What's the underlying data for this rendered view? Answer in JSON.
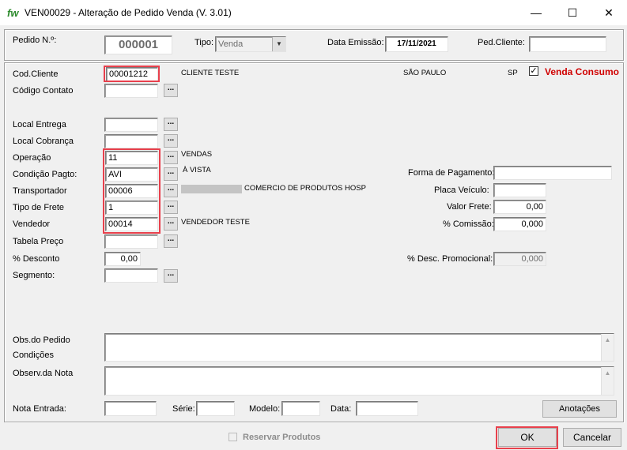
{
  "window": {
    "logo": "fw",
    "title": "VEN00029 - Alteração de Pedido Venda  (V. 3.01)",
    "minimize": "—",
    "maximize": "☐",
    "close": "✕"
  },
  "header": {
    "pedido_label": "Pedido N.º:",
    "pedido_value": "000001",
    "tipo_label": "Tipo:",
    "tipo_value": "Venda",
    "data_emissao_label": "Data Emissão:",
    "data_emissao_value": "17/11/2021",
    "ped_cliente_label": "Ped.Cliente:",
    "ped_cliente_value": ""
  },
  "form": {
    "cod_cliente_label": "Cod.Cliente",
    "cod_cliente_value": "00001212",
    "cliente_nome": "CLIENTE TESTE",
    "cidade": "SÃO PAULO",
    "uf": "SP",
    "venda_consumo_label": "Venda Consumo",
    "venda_consumo_checked": true,
    "codigo_contato_label": "Código Contato",
    "local_entrega_label": "Local Entrega",
    "local_cobranca_label": "Local Cobrança",
    "operacao_label": "Operação",
    "operacao_value": "11",
    "operacao_desc": "VENDAS",
    "condicao_label": "Condição Pagto:",
    "condicao_value": "AVI",
    "condicao_desc": "À VISTA",
    "transportador_label": "Transportador",
    "transportador_value": "00006",
    "transportador_desc": "COMERCIO DE PRODUTOS HOSP",
    "tipo_frete_label": "Tipo de Frete",
    "tipo_frete_value": "1",
    "vendedor_label": "Vendedor",
    "vendedor_value": "00014",
    "vendedor_desc": "VENDEDOR TESTE",
    "tabela_preco_label": "Tabela  Preço",
    "desconto_label": "% Desconto",
    "desconto_value": "0,00",
    "segmento_label": "Segmento:",
    "forma_pagamento_label": "Forma de Pagamento:",
    "placa_veiculo_label": "Placa Veículo:",
    "valor_frete_label": "Valor Frete:",
    "valor_frete_value": "0,00",
    "comissao_label": "% Comissão:",
    "comissao_value": "0,000",
    "desc_promocional_label": "% Desc. Promocional:",
    "desc_promocional_value": "0,000",
    "obs_pedido_label": "Obs.do Pedido",
    "condicoes_label": "Condições",
    "observ_nota_label": "Observ.da Nota",
    "nota_entrada_label": "Nota Entrada:",
    "serie_label": "Série:",
    "modelo_label": "Modelo:",
    "data_label": "Data:",
    "anotacoes_button": "Anotações"
  },
  "footer": {
    "reservar_label": "Reservar Produtos",
    "ok_button": "OK",
    "cancelar_button": "Cancelar"
  },
  "colors": {
    "highlight_red": "#e8404c",
    "venda_consumo_red": "#d00000"
  }
}
